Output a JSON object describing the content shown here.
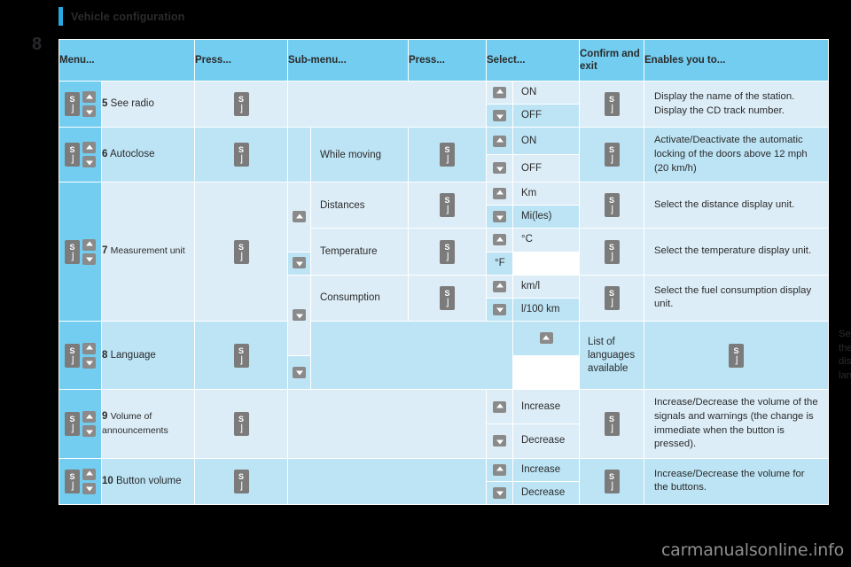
{
  "document": {
    "section_title": "Vehicle configuration",
    "page_number": "8",
    "watermark": "carmanualsonline.info"
  },
  "table": {
    "headers": {
      "menu": "Menu...",
      "press1": "Press...",
      "submenu": "Sub-menu...",
      "press2": "Press...",
      "select": "Select...",
      "confirm": "Confirm and exit",
      "enables": "Enables you to..."
    },
    "icons": {
      "s_button": "s-return-button-icon",
      "arrow_up": "arrow-up-button-icon",
      "arrow_down": "arrow-down-button-icon"
    },
    "rows": [
      {
        "number": "5",
        "name": "See radio",
        "name_style": "normal",
        "submenu": "",
        "options": [
          "ON",
          "OFF"
        ],
        "description": "Display the name of the station. Display the CD track number."
      },
      {
        "number": "6",
        "name": "Autoclose",
        "name_style": "normal",
        "submenu": "While moving",
        "options": [
          "ON",
          "OFF"
        ],
        "description": "Activate/Deactivate the automatic locking of the doors above 12 mph (20 km/h)"
      },
      {
        "number": "7",
        "name": "Measurement unit",
        "name_style": "small",
        "subrows": [
          {
            "submenu": "Distances",
            "options": [
              "Km",
              "Mi(les)"
            ],
            "description": "Select the distance display unit."
          },
          {
            "submenu": "Temperature",
            "options": [
              "°C",
              "°F"
            ],
            "description": "Select the temperature display unit."
          },
          {
            "submenu": "Consumption",
            "options": [
              "km/l",
              "l/100 km"
            ],
            "description": "Select the fuel consumption display unit."
          }
        ]
      },
      {
        "number": "8",
        "name": "Language",
        "name_style": "normal",
        "submenu": "",
        "options": [
          "List of languages available"
        ],
        "description": "Select the display language."
      },
      {
        "number": "9",
        "name": "Volume of announcements",
        "name_style": "small",
        "submenu": "",
        "options": [
          "Increase",
          "Decrease"
        ],
        "description": "Increase/Decrease the volume of the signals and warnings (the change is immediate when the button is pressed)."
      },
      {
        "number": "10",
        "name": "Button volume",
        "name_style": "normal",
        "submenu": "",
        "options": [
          "Increase",
          "Decrease"
        ],
        "description": "Increase/Decrease the volume for the buttons."
      }
    ]
  }
}
